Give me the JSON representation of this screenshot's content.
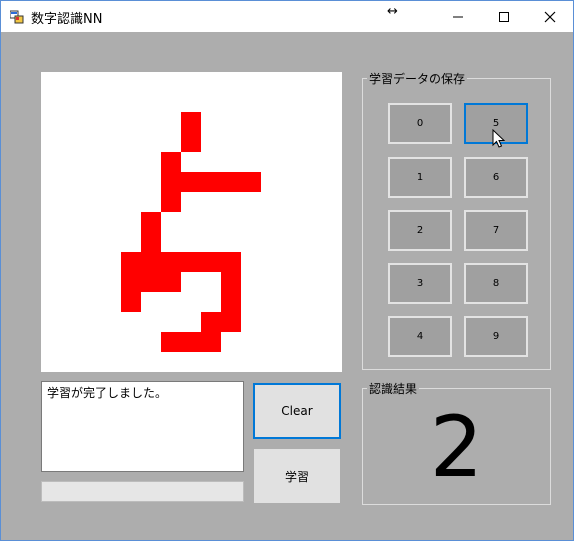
{
  "window": {
    "title": "数字認識NN",
    "minimize_label": "—",
    "maximize_label": "☐",
    "close_label": "✕",
    "resize_label": "↔"
  },
  "drawing_canvas": {
    "cell_color": "#ff0000"
  },
  "log": {
    "text": "学習が完了しました。"
  },
  "buttons": {
    "clear": "Clear",
    "train": "学習"
  },
  "save_group": {
    "title": "学習データの保存",
    "digits": [
      "0",
      "1",
      "2",
      "3",
      "4",
      "5",
      "6",
      "7",
      "8",
      "9"
    ]
  },
  "result_group": {
    "title": "認識結果",
    "value": "2"
  },
  "colors": {
    "accent": "#0078d7",
    "stroke": "#ff0000",
    "background": "#adadad"
  }
}
